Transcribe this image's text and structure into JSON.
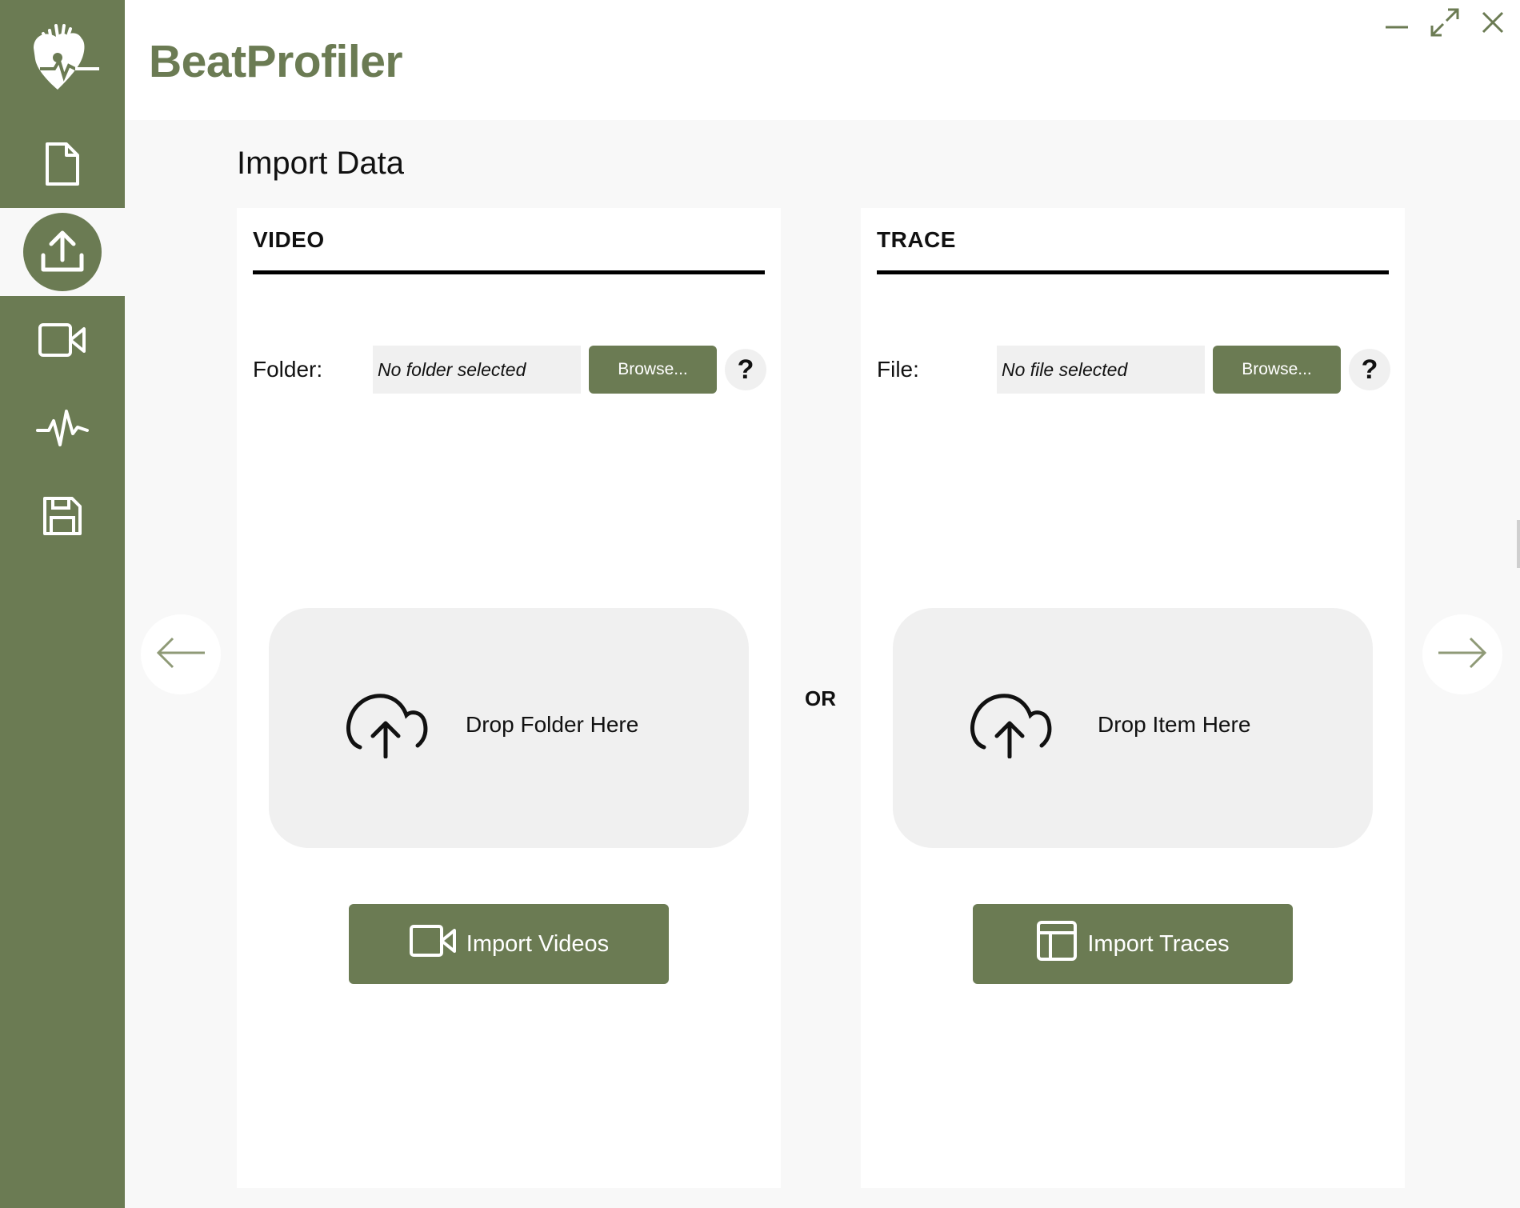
{
  "app": {
    "title": "BeatProfiler"
  },
  "page": {
    "title": "Import Data"
  },
  "sidebar": {
    "items": [
      {
        "name": "file-icon",
        "active": false
      },
      {
        "name": "upload-icon",
        "active": true
      },
      {
        "name": "video-camera-icon",
        "active": false
      },
      {
        "name": "waveform-icon",
        "active": false
      },
      {
        "name": "save-icon",
        "active": false
      }
    ]
  },
  "video_panel": {
    "heading": "VIDEO",
    "field_label": "Folder:",
    "field_value": "No folder selected",
    "browse_label": "Browse...",
    "help_label": "?",
    "drop_text": "Drop Folder Here",
    "import_label": "Import Videos"
  },
  "trace_panel": {
    "heading": "TRACE",
    "field_label": "File:",
    "field_value": "No file selected",
    "browse_label": "Browse...",
    "help_label": "?",
    "drop_text": "Drop Item Here",
    "import_label": "Import Traces"
  },
  "separator": {
    "label": "OR"
  },
  "colors": {
    "accent": "#6b7b53",
    "panel_bg": "#ffffff",
    "page_bg": "#f8f8f8",
    "field_bg": "#f0f0f0"
  }
}
